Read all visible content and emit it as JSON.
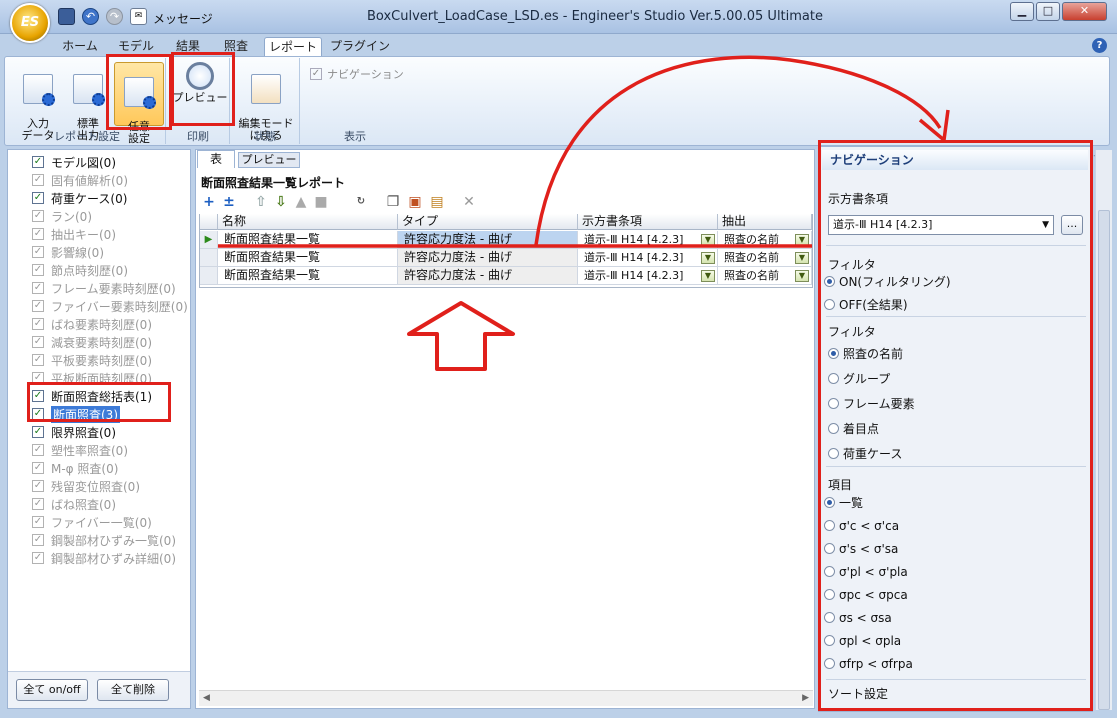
{
  "window": {
    "title": "BoxCulvert_LoadCase_LSD.es - Engineer's Studio Ver.5.00.05 Ultimate",
    "logo": "ES",
    "qa_label": "メッセージ",
    "controls": [
      "minimize",
      "maximize",
      "close"
    ]
  },
  "ribbon_tabs": [
    "ホーム",
    "モデル",
    "結果",
    "照査",
    "レポート",
    "プラグイン"
  ],
  "ribbon": {
    "btn_input": "入力\nデータ",
    "btn_standard": "標準\n出力",
    "btn_custom": "任意\n設定",
    "btn_preview": "プレビュー",
    "btn_edit_mode": "編集モード\nに戻る",
    "nav_checkbox": "ナビゲーション",
    "group_report": "レポート設定",
    "group_print": "印刷",
    "group_state": "状態",
    "group_display": "表示"
  },
  "tree": [
    {
      "label": "モデル図(0)",
      "checked": true,
      "disabled": false
    },
    {
      "label": "固有値解析(0)",
      "checked": true,
      "disabled": true
    },
    {
      "label": "荷重ケース(0)",
      "checked": true,
      "disabled": false
    },
    {
      "label": "ラン(0)",
      "checked": true,
      "disabled": true
    },
    {
      "label": "抽出キー(0)",
      "checked": true,
      "disabled": true
    },
    {
      "label": "影響線(0)",
      "checked": true,
      "disabled": true
    },
    {
      "label": "節点時刻歴(0)",
      "checked": true,
      "disabled": true
    },
    {
      "label": "フレーム要素時刻歴(0)",
      "checked": true,
      "disabled": true
    },
    {
      "label": "ファイバー要素時刻歴(0)",
      "checked": true,
      "disabled": true
    },
    {
      "label": "ばね要素時刻歴(0)",
      "checked": true,
      "disabled": true
    },
    {
      "label": "減衰要素時刻歴(0)",
      "checked": true,
      "disabled": true
    },
    {
      "label": "平板要素時刻歴(0)",
      "checked": true,
      "disabled": true
    },
    {
      "label": "平板断面時刻歴(0)",
      "checked": true,
      "disabled": true
    },
    {
      "label": "断面照査総括表(1)",
      "checked": true,
      "disabled": false
    },
    {
      "label": "断面照査(3)",
      "checked": true,
      "disabled": false,
      "selected": true
    },
    {
      "label": "限界照査(0)",
      "checked": true,
      "disabled": false
    },
    {
      "label": "塑性率照査(0)",
      "checked": true,
      "disabled": true
    },
    {
      "label": "M-φ 照査(0)",
      "checked": true,
      "disabled": true
    },
    {
      "label": "残留変位照査(0)",
      "checked": true,
      "disabled": true
    },
    {
      "label": "ばね照査(0)",
      "checked": true,
      "disabled": true
    },
    {
      "label": "ファイバー一覧(0)",
      "checked": true,
      "disabled": true
    },
    {
      "label": "鋼製部材ひずみ一覧(0)",
      "checked": true,
      "disabled": true
    },
    {
      "label": "鋼製部材ひずみ詳細(0)",
      "checked": true,
      "disabled": true
    }
  ],
  "left_buttons": {
    "all_on": "全て on/off",
    "delete_all": "全て削除"
  },
  "center": {
    "tab_table": "表",
    "tab_preview": "プレビュー",
    "report_title": "断面照査結果一覧レポート",
    "columns": [
      "名称",
      "タイプ",
      "示方書条項",
      "抽出"
    ],
    "rows": [
      {
        "name": "断面照査結果一覧",
        "type": "許容応力度法 - 曲げ",
        "clause": "道示-Ⅲ H14 [4.2.3]",
        "extract": "照査の名前"
      },
      {
        "name": "断面照査結果一覧",
        "type": "許容応力度法 - 曲げ",
        "clause": "道示-Ⅲ H14 [4.2.3]",
        "extract": "照査の名前"
      },
      {
        "name": "断面照査結果一覧",
        "type": "許容応力度法 - 曲げ",
        "clause": "道示-Ⅲ H14 [4.2.3]",
        "extract": "照査の名前"
      }
    ]
  },
  "nav": {
    "title": "ナビゲーション",
    "sec_clause": "示方書条項",
    "clause_value": "道示-Ⅲ H14 [4.2.3]",
    "browse_btn": "...",
    "sec_filter1": "フィルタ",
    "filter1_options": [
      {
        "label": "ON(フィルタリング)",
        "on": true
      },
      {
        "label": "OFF(全結果)",
        "on": false
      }
    ],
    "sec_filter2": "フィルタ",
    "filter2_options": [
      {
        "label": "照査の名前",
        "on": true
      },
      {
        "label": "グループ",
        "on": false
      },
      {
        "label": "フレーム要素",
        "on": false
      },
      {
        "label": "着目点",
        "on": false
      },
      {
        "label": "荷重ケース",
        "on": false
      }
    ],
    "sec_items": "項目",
    "item_options": [
      {
        "label": "一覧",
        "on": true
      },
      {
        "label": "σ'c < σ'ca",
        "on": false
      },
      {
        "label": "σ's < σ'sa",
        "on": false
      },
      {
        "label": "σ'pl < σ'pla",
        "on": false
      },
      {
        "label": "σpc < σpca",
        "on": false
      },
      {
        "label": "σs < σsa",
        "on": false
      },
      {
        "label": "σpl < σpla",
        "on": false
      },
      {
        "label": "σfrp < σfrpa",
        "on": false
      }
    ],
    "sec_sort": "ソート設定"
  },
  "colors": {
    "highlight": "#e0201b",
    "selection": "#3d7bd8",
    "ribbon_bg": "#dbe7f5",
    "title_bar": "#bcd0e8"
  }
}
